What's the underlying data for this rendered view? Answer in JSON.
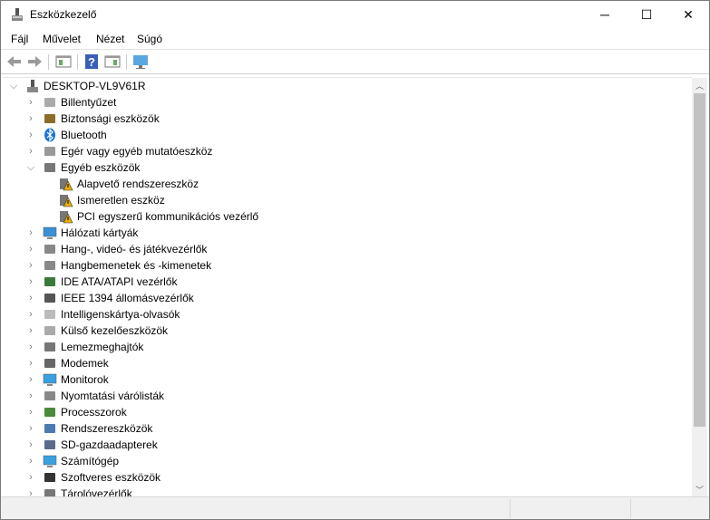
{
  "window": {
    "title": "Eszközkezelő",
    "minimize": "─",
    "maximize": "☐",
    "close": "✕"
  },
  "menu": [
    "Fájl",
    "Művelet",
    "Nézet",
    "Súgó"
  ],
  "toolbar": [
    {
      "name": "back-icon"
    },
    {
      "name": "forward-icon"
    },
    {
      "name": "properties-icon"
    },
    {
      "name": "help-icon"
    },
    {
      "name": "update-driver-icon"
    },
    {
      "name": "scan-hardware-icon"
    }
  ],
  "tree": {
    "root": {
      "label": "DESKTOP-VL9V61R",
      "expanded": true
    },
    "items": [
      {
        "label": "Billentyűzet",
        "icon": "keyboard-icon",
        "level": 1,
        "expanded": false
      },
      {
        "label": "Biztonsági eszközök",
        "icon": "security-device-icon",
        "level": 1,
        "expanded": false
      },
      {
        "label": "Bluetooth",
        "icon": "bluetooth-icon",
        "level": 1,
        "expanded": false
      },
      {
        "label": "Egér vagy egyéb mutatóeszköz",
        "icon": "mouse-icon",
        "level": 1,
        "expanded": false
      },
      {
        "label": "Egyéb eszközök",
        "icon": "unknown-device-icon",
        "level": 1,
        "expanded": true
      },
      {
        "label": "Alapvető rendszereszköz",
        "icon": "warning-device-icon",
        "level": 2
      },
      {
        "label": "Ismeretlen eszköz",
        "icon": "warning-device-icon",
        "level": 2
      },
      {
        "label": "PCI egyszerű kommunikációs vezérlő",
        "icon": "warning-device-icon",
        "level": 2
      },
      {
        "label": "Hálózati kártyák",
        "icon": "network-adapter-icon",
        "level": 1,
        "expanded": false
      },
      {
        "label": "Hang-, videó- és játékvezérlők",
        "icon": "speaker-icon",
        "level": 1,
        "expanded": false
      },
      {
        "label": "Hangbemenetek és -kimenetek",
        "icon": "speaker-icon",
        "level": 1,
        "expanded": false
      },
      {
        "label": "IDE ATA/ATAPI vezérlők",
        "icon": "ide-controller-icon",
        "level": 1,
        "expanded": false
      },
      {
        "label": "IEEE 1394 állomásvezérlők",
        "icon": "firewire-icon",
        "level": 1,
        "expanded": false
      },
      {
        "label": "Intelligenskártya-olvasók",
        "icon": "smartcard-reader-icon",
        "level": 1,
        "expanded": false
      },
      {
        "label": "Külső kezelőeszközök",
        "icon": "hid-icon",
        "level": 1,
        "expanded": false
      },
      {
        "label": "Lemezmeghajtók",
        "icon": "disk-drive-icon",
        "level": 1,
        "expanded": false
      },
      {
        "label": "Modemek",
        "icon": "modem-icon",
        "level": 1,
        "expanded": false
      },
      {
        "label": "Monitorok",
        "icon": "monitor-icon",
        "level": 1,
        "expanded": false
      },
      {
        "label": "Nyomtatási várólisták",
        "icon": "printer-icon",
        "level": 1,
        "expanded": false
      },
      {
        "label": "Processzorok",
        "icon": "processor-icon",
        "level": 1,
        "expanded": false
      },
      {
        "label": "Rendszereszközök",
        "icon": "system-device-icon",
        "level": 1,
        "expanded": false
      },
      {
        "label": "SD-gazdaadapterek",
        "icon": "sd-adapter-icon",
        "level": 1,
        "expanded": false
      },
      {
        "label": "Számítógép",
        "icon": "computer-icon",
        "level": 1,
        "expanded": false
      },
      {
        "label": "Szoftveres eszközök",
        "icon": "software-device-icon",
        "level": 1,
        "expanded": false
      },
      {
        "label": "Tárolóvezérlők",
        "icon": "storage-controller-icon",
        "level": 1,
        "expanded": false
      }
    ]
  },
  "scrollbar": {
    "position_fraction": 0,
    "visible_fraction": 0.8
  }
}
